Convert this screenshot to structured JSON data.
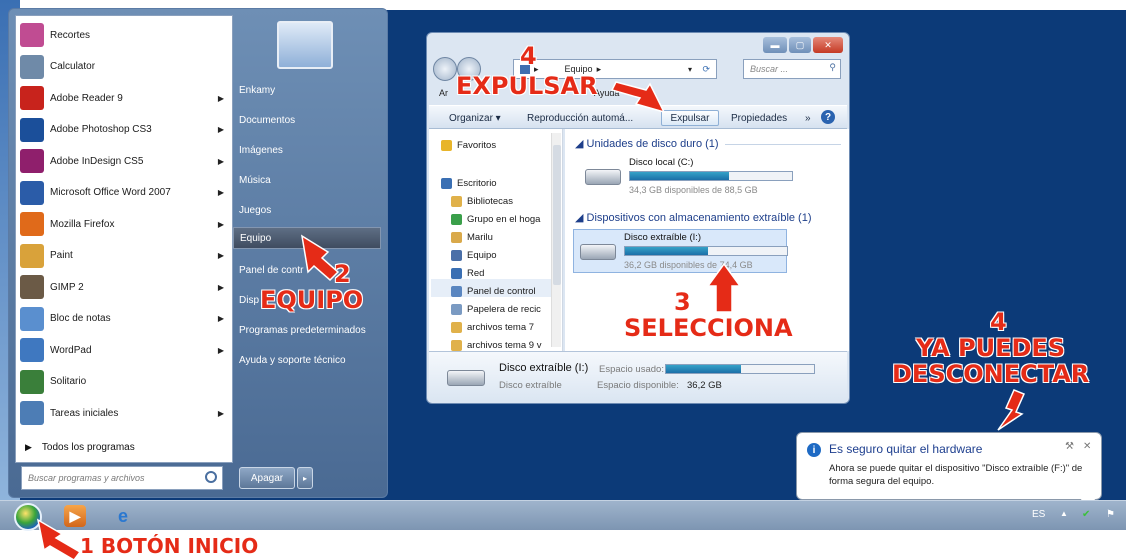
{
  "start_menu": {
    "programs": [
      {
        "label": "Recortes",
        "icon": "scissors-icon",
        "color": "#c04c92",
        "has_arrow": false
      },
      {
        "label": "Calculator",
        "icon": "calculator-icon",
        "color": "#6f8aa8",
        "has_arrow": false
      },
      {
        "label": "Adobe Reader 9",
        "icon": "adobe-reader-icon",
        "color": "#c8231c",
        "has_arrow": true
      },
      {
        "label": "Adobe Photoshop CS3",
        "icon": "photoshop-icon",
        "color": "#1b4f9a",
        "has_arrow": true
      },
      {
        "label": "Adobe InDesign CS5",
        "icon": "indesign-icon",
        "color": "#8f1f6c",
        "has_arrow": true
      },
      {
        "label": "Microsoft Office Word 2007",
        "icon": "word-icon",
        "color": "#2b5ca8",
        "has_arrow": true
      },
      {
        "label": "Mozilla Firefox",
        "icon": "firefox-icon",
        "color": "#e06a1a",
        "has_arrow": true
      },
      {
        "label": "Paint",
        "icon": "paint-icon",
        "color": "#d9a23a",
        "has_arrow": true
      },
      {
        "label": "GIMP 2",
        "icon": "gimp-icon",
        "color": "#6b5a46",
        "has_arrow": true
      },
      {
        "label": "Bloc de notas",
        "icon": "notepad-icon",
        "color": "#5a8fcf",
        "has_arrow": true
      },
      {
        "label": "WordPad",
        "icon": "wordpad-icon",
        "color": "#3f78c0",
        "has_arrow": true
      },
      {
        "label": "Solitario",
        "icon": "solitaire-icon",
        "color": "#3a7f3a",
        "has_arrow": false
      },
      {
        "label": "Tareas iniciales",
        "icon": "getting-started-icon",
        "color": "#4d7db5",
        "has_arrow": true
      }
    ],
    "all_programs": "Todos los programas",
    "search_placeholder": "Buscar programas y archivos",
    "right_items": [
      "Enkamy",
      "Documentos",
      "Imágenes",
      "Música",
      "Juegos",
      "Equipo",
      "Panel de contr",
      "Disp",
      "Programas predeterminados",
      "Ayuda y soporte técnico"
    ],
    "shutdown": "Apagar"
  },
  "explorer": {
    "address": "Equipo",
    "search_placeholder": "Buscar ...",
    "menu": [
      "Ar",
      "Ayuda"
    ],
    "toolbar": [
      "Organizar ▾",
      "Reproducción automá...",
      "Expulsar",
      "Propiedades",
      "»"
    ],
    "nav": [
      {
        "label": "Favoritos",
        "icon": "star-icon",
        "color": "#e8b52a"
      },
      {
        "label": "Escritorio",
        "icon": "desktop-icon",
        "color": "#3a6fb3"
      },
      {
        "label": "Bibliotecas",
        "icon": "library-icon",
        "color": "#e0b14a"
      },
      {
        "label": "Grupo en el hoga",
        "icon": "homegroup-icon",
        "color": "#3a9f4a"
      },
      {
        "label": "Marilu",
        "icon": "user-folder-icon",
        "color": "#d9a94a"
      },
      {
        "label": "Equipo",
        "icon": "computer-icon",
        "color": "#4a6fa8"
      },
      {
        "label": "Red",
        "icon": "network-icon",
        "color": "#3a6fb3"
      },
      {
        "label": "Panel de control",
        "icon": "control-panel-icon",
        "color": "#5a86c0"
      },
      {
        "label": "Papelera de recic",
        "icon": "recycle-bin-icon",
        "color": "#7a9ac2"
      },
      {
        "label": "archivos tema 7",
        "icon": "folder-icon",
        "color": "#e0b14a"
      },
      {
        "label": "archivos tema 9 v",
        "icon": "folder-icon",
        "color": "#e0b14a"
      }
    ],
    "groups": [
      {
        "title": "Unidades de disco duro (1)"
      },
      {
        "title": "Dispositivos con almacenamiento extraíble (1)"
      }
    ],
    "drives": [
      {
        "name": "Disco local (C:)",
        "free": "34,3 GB disponibles de 88,5 GB",
        "used_fraction": 0.61
      },
      {
        "name": "Disco extraíble (I:)",
        "free": "36,2 GB disponibles de 74,4 GB",
        "used_fraction": 0.51
      }
    ],
    "details": {
      "name": "Disco extraíble (I:)",
      "type": "Disco extraíble",
      "used_label": "Espacio usado:",
      "free_label": "Espacio disponible:",
      "free_value": "36,2 GB",
      "used_fraction": 0.51
    }
  },
  "notification": {
    "title": "Es seguro quitar el hardware",
    "text": "Ahora se puede quitar el dispositivo \"Disco extraíble (F:)\" de forma segura del equipo."
  },
  "taskbar": {
    "language": "ES"
  },
  "annotations": {
    "step1": "1 BOTÓN INICIO",
    "step2_num": "2",
    "step2_text": "EQUIPO",
    "step3_num": "3",
    "step3_text": "SELECCIONA",
    "step4a_num": "4",
    "step4a_text": "EXPULSAR",
    "step4b_num": "4",
    "step4b_line1": "YA PUEDES",
    "step4b_line2": "DESCONECTAR"
  },
  "colors": {
    "annotation": "#e52b17",
    "desktop": "#0c3a78",
    "accent": "#1e3f8f"
  }
}
